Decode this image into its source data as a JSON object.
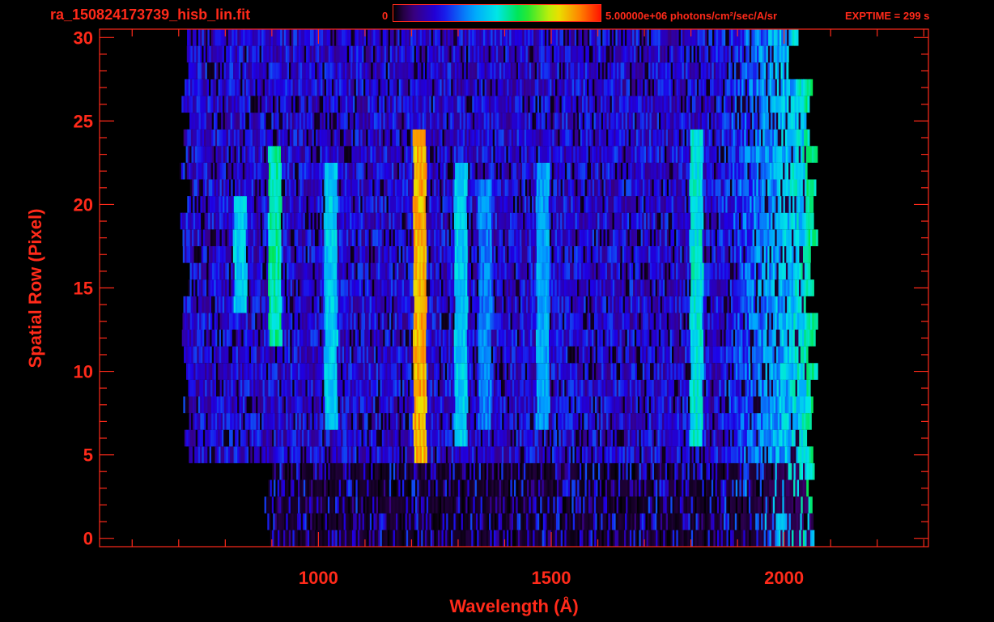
{
  "header": {
    "title": "ra_150824173739_hisb_lin.fit",
    "colorbar_min_label": "0",
    "colorbar_max_label": "5.00000e+06 photons/cm²/sec/A/sr",
    "exptime_label": "EXPTIME = 299 s"
  },
  "colors": {
    "axis": "#ff2a1a",
    "background": "#000000"
  },
  "chart_data": {
    "type": "heatmap",
    "title": "ra_150824173739_hisb_lin.fit",
    "xlabel": "Wavelength (Å)",
    "ylabel": "Spatial Row (Pixel)",
    "xlim": [
      530,
      2310
    ],
    "ylim": [
      -0.5,
      30.5
    ],
    "x_ticks": [
      1000,
      1500,
      2000
    ],
    "y_ticks": [
      0,
      5,
      10,
      15,
      20,
      25,
      30
    ],
    "colormap": "rainbow",
    "color_range": [
      0,
      5000000
    ],
    "color_units": "photons/cm²/sec/A/sr",
    "rows": [
      0,
      30
    ],
    "wavelength_coverage": [
      700,
      2090
    ],
    "emission_features": [
      {
        "wavelength": 830,
        "rows": [
          14,
          20
        ],
        "level": 0.45
      },
      {
        "wavelength": 905,
        "rows": [
          12,
          23
        ],
        "level": 0.55
      },
      {
        "wavelength": 1025,
        "rows": [
          7,
          22
        ],
        "level": 0.45
      },
      {
        "wavelength": 1216,
        "rows": [
          5,
          24
        ],
        "level": 0.85
      },
      {
        "wavelength": 1304,
        "rows": [
          6,
          22
        ],
        "level": 0.45
      },
      {
        "wavelength": 1356,
        "rows": [
          7,
          21
        ],
        "level": 0.35
      },
      {
        "wavelength": 1480,
        "rows": [
          7,
          22
        ],
        "level": 0.4
      },
      {
        "wavelength": 1810,
        "rows": [
          6,
          24
        ],
        "level": 0.5
      },
      {
        "wavelength": 2060,
        "rows": [
          3,
          30
        ],
        "level": 0.55
      }
    ]
  }
}
